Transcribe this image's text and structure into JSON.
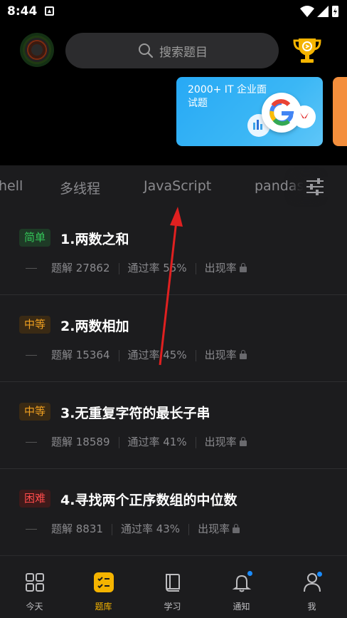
{
  "status_bar": {
    "time": "8:44"
  },
  "header": {
    "search_placeholder": "搜索题目"
  },
  "banner": {
    "text": "2000+ IT 企业面试题"
  },
  "categories": [
    "hell",
    "多线程",
    "JavaScript",
    "pandas"
  ],
  "questions": [
    {
      "difficulty": "简单",
      "title": "1.两数之和",
      "solutions": "题解 27862",
      "pass_rate": "通过率 55%",
      "frequency": "出现率"
    },
    {
      "difficulty": "中等",
      "title": "2.两数相加",
      "solutions": "题解 15364",
      "pass_rate": "通过率 45%",
      "frequency": "出现率"
    },
    {
      "difficulty": "中等",
      "title": "3.无重复字符的最长子串",
      "solutions": "题解 18589",
      "pass_rate": "通过率 41%",
      "frequency": "出现率"
    },
    {
      "difficulty": "困难",
      "title": "4.寻找两个正序数组的中位数",
      "solutions": "题解 8831",
      "pass_rate": "通过率 43%",
      "frequency": "出现率"
    }
  ],
  "nav": [
    {
      "label": "今天",
      "icon": "grid-icon"
    },
    {
      "label": "题库",
      "icon": "checklist-icon",
      "active": true
    },
    {
      "label": "学习",
      "icon": "book-icon"
    },
    {
      "label": "通知",
      "icon": "bell-icon"
    },
    {
      "label": "我",
      "icon": "person-icon"
    }
  ],
  "colors": {
    "accent": "#f5b400",
    "easy": "#34c759",
    "medium": "#f0a020",
    "hard": "#ff4b4b",
    "arrow": "#e02020",
    "notification_dot": "#1a8cff"
  }
}
